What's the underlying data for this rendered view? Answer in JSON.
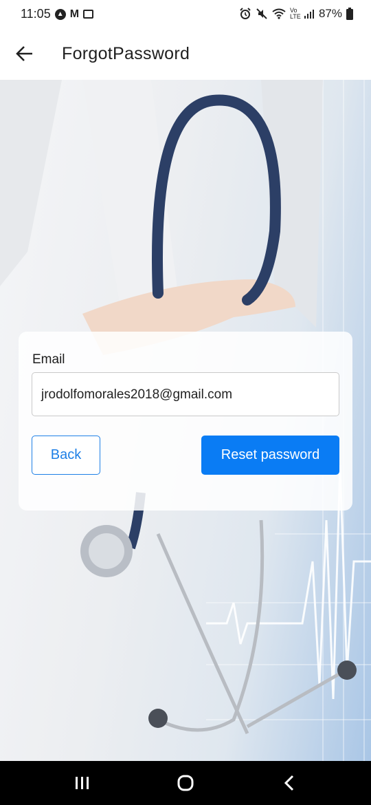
{
  "status_bar": {
    "time": "11:05",
    "left_icons": [
      "app-a-icon",
      "gmail-icon",
      "gallery-icon"
    ],
    "right_icons": [
      "alarm-icon",
      "mute-icon",
      "wifi-icon",
      "volte-icon",
      "signal-icon",
      "battery-icon"
    ],
    "volte_text": "Vo LTE",
    "battery": "87%"
  },
  "app_bar": {
    "title": "ForgotPassword",
    "back_icon": "arrow-left-icon"
  },
  "background": {
    "description_icon": "stethoscope-doctor-image"
  },
  "form": {
    "email_label": "Email",
    "email_value": "jrodolfomorales2018@gmail.com",
    "back_label": "Back",
    "reset_label": "Reset password",
    "accent_color": "#0a7cf4"
  },
  "nav_bar": {
    "buttons": [
      "recent-apps-icon",
      "home-icon",
      "back-icon"
    ]
  }
}
